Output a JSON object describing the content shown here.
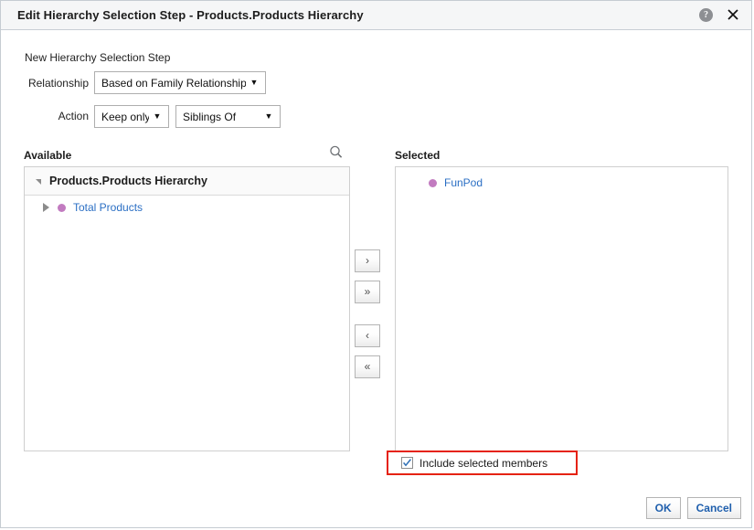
{
  "titlebar": {
    "title": "Edit Hierarchy Selection Step - Products.Products Hierarchy",
    "help_icon": "help-icon",
    "help_glyph": "?",
    "close_icon": "close-icon"
  },
  "form": {
    "caption": "New Hierarchy Selection Step",
    "relationship_label": "Relationship",
    "relationship_value": "Based on Family Relationship",
    "action_label": "Action",
    "action_value": "Keep only",
    "action_target_value": "Siblings Of",
    "dropdown_arrow": "▼"
  },
  "available": {
    "heading": "Available",
    "search_icon": "search-icon",
    "tree_root": "Products.Products Hierarchy",
    "items": [
      {
        "label": "Total Products",
        "bullet_color": "#c27bc0"
      }
    ]
  },
  "selected": {
    "heading": "Selected",
    "items": [
      {
        "label": "FunPod",
        "bullet_color": "#c27bc0"
      }
    ]
  },
  "transfer": {
    "move_right_label": "›",
    "move_all_right_label": "»",
    "move_left_label": "‹",
    "move_all_left_label": "«"
  },
  "options": {
    "include_selected_members_label": "Include selected members",
    "include_selected_members_checked": true,
    "highlight_color": "#e52210"
  },
  "footer": {
    "ok_label": "OK",
    "cancel_label": "Cancel"
  },
  "colors": {
    "link": "#2b6fc4",
    "bullet": "#c27bc0",
    "titlebar_bg": "#f5f6f7",
    "button_text": "#1f5fad"
  }
}
